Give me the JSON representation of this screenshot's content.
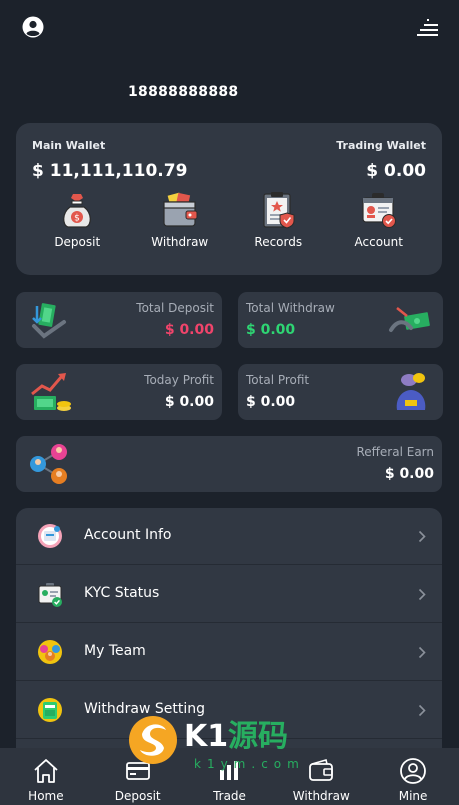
{
  "header": {
    "profile_icon": "user-circle-icon",
    "menu_icon": "menu-lines-icon",
    "phone": "18888888888"
  },
  "wallet": {
    "main_label": "Main Wallet",
    "main_amount": "$ 11,111,110.79",
    "trading_label": "Trading Wallet",
    "trading_amount": "$ 0.00",
    "actions": [
      {
        "label": "Deposit",
        "icon": "money-bag-icon"
      },
      {
        "label": "Withdraw",
        "icon": "wallet-icon"
      },
      {
        "label": "Records",
        "icon": "clipboard-icon"
      },
      {
        "label": "Account",
        "icon": "id-card-icon"
      }
    ]
  },
  "stats": {
    "total_deposit": {
      "label": "Total Deposit",
      "value": "$ 0.00",
      "color": "#f0446b"
    },
    "total_withdraw": {
      "label": "Total Withdraw",
      "value": "$ 0.00",
      "color": "#2ed573"
    },
    "today_profit": {
      "label": "Today Profit",
      "value": "$ 0.00"
    },
    "total_profit": {
      "label": "Total Profit",
      "value": "$ 0.00"
    },
    "referral_earn": {
      "label": "Refferal Earn",
      "value": "$ 0.00"
    }
  },
  "menu": {
    "items": [
      {
        "label": "Account Info",
        "icon": "account-info-icon"
      },
      {
        "label": "KYC Status",
        "icon": "kyc-icon"
      },
      {
        "label": "My Team",
        "icon": "team-icon"
      },
      {
        "label": "Withdraw Setting",
        "icon": "withdraw-setting-icon"
      }
    ]
  },
  "nav": {
    "items": [
      {
        "label": "Home",
        "icon": "home-icon"
      },
      {
        "label": "Deposit",
        "icon": "card-icon"
      },
      {
        "label": "Trade",
        "icon": "trade-icon"
      },
      {
        "label": "Withdraw",
        "icon": "wallet-icon"
      },
      {
        "label": "Mine",
        "icon": "user-circle-icon"
      }
    ]
  },
  "watermark": {
    "brand": "K1源码",
    "domain": "k1ym.com"
  },
  "colors": {
    "background": "#1c222b",
    "card": "#313843",
    "nav": "#2e343e"
  }
}
